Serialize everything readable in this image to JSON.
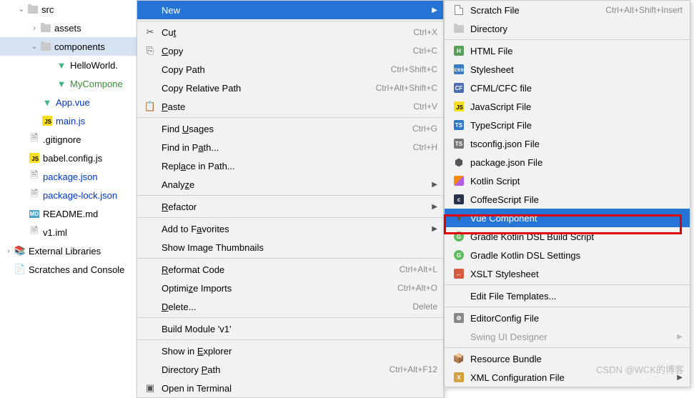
{
  "tree": {
    "src": "src",
    "assets": "assets",
    "components": "components",
    "helloworld": "HelloWorld.",
    "mycompone": "MyCompone",
    "appvue": "App.vue",
    "mainjs": "main.js",
    "gitignore": ".gitignore",
    "babelconfig": "babel.config.js",
    "packagejson": "package.json",
    "packagelock": "package-lock.json",
    "readme": "README.md",
    "v1iml": "v1.iml",
    "extlib": "External Libraries",
    "scratches": "Scratches and Console"
  },
  "menu1": {
    "new": "New",
    "cut": "Cut",
    "cut_sc": "Ctrl+X",
    "copy": "Copy",
    "copy_sc": "Ctrl+C",
    "copypath": "Copy Path",
    "copypath_sc": "Ctrl+Shift+C",
    "copyrel": "Copy Relative Path",
    "copyrel_sc": "Ctrl+Alt+Shift+C",
    "paste": "Paste",
    "paste_sc": "Ctrl+V",
    "findusages": "Find Usages",
    "findusages_sc": "Ctrl+G",
    "findinpath": "Find in Path...",
    "findinpath_sc": "Ctrl+H",
    "replaceinpath": "Replace in Path...",
    "analyze": "Analyze",
    "refactor": "Refactor",
    "addfav": "Add to Favorites",
    "showimg": "Show Image Thumbnails",
    "reformat": "Reformat Code",
    "reformat_sc": "Ctrl+Alt+L",
    "optimize": "Optimize Imports",
    "optimize_sc": "Ctrl+Alt+O",
    "delete": "Delete...",
    "delete_sc": "Delete",
    "buildmod": "Build Module 'v1'",
    "showexp": "Show in Explorer",
    "dirpath": "Directory Path",
    "dirpath_sc": "Ctrl+Alt+F12",
    "openterm": "Open in Terminal"
  },
  "menu2": {
    "scratch": "Scratch File",
    "scratch_sc": "Ctrl+Alt+Shift+Insert",
    "directory": "Directory",
    "htmlfile": "HTML File",
    "stylesheet": "Stylesheet",
    "cfml": "CFML/CFC file",
    "jsfile": "JavaScript File",
    "tsfile": "TypeScript File",
    "tsconfig": "tsconfig.json File",
    "pkgjson": "package.json File",
    "kotlin": "Kotlin Script",
    "coffee": "CoffeeScript File",
    "vuecomp": "Vue Component",
    "gradlekb": "Gradle Kotlin DSL Build Script",
    "gradleks": "Gradle Kotlin DSL Settings",
    "xslt": "XSLT Stylesheet",
    "editft": "Edit File Templates...",
    "editorcfg": "EditorConfig File",
    "swingui": "Swing UI Designer",
    "resbundle": "Resource Bundle",
    "xmlcfg": "XML Configuration File"
  },
  "watermark": "CSDN @WCK的博客"
}
